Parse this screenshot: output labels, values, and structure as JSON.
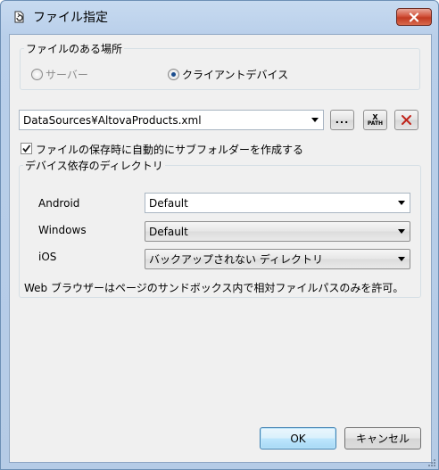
{
  "window": {
    "title": "ファイル指定"
  },
  "location_group": {
    "legend": "ファイルのある場所",
    "options": [
      {
        "label": "サーバー",
        "selected": false,
        "enabled": false
      },
      {
        "label": "クライアントデバイス",
        "selected": true,
        "enabled": true
      }
    ]
  },
  "file": {
    "path": "DataSources¥AltovaProducts.xml",
    "browse_label": "...",
    "xpath_label_top": "X",
    "xpath_label_bottom": "PATH"
  },
  "subfolder_checkbox": {
    "label": "ファイルの保存時に自動的にサブフォルダーを作成する",
    "checked": true
  },
  "device_dirs": {
    "legend": "デバイス依存のディレクトリ",
    "rows": [
      {
        "label": "Android",
        "value": "Default"
      },
      {
        "label": "Windows",
        "value": "Default"
      },
      {
        "label": "iOS",
        "value": "バックアップされない ディレクトリ"
      }
    ],
    "note": "Web ブラウザーはページのサンドボックス内で相対ファイルパスのみを許可。"
  },
  "buttons": {
    "ok": "OK",
    "cancel": "キャンセル"
  },
  "colors": {
    "accent": "#1b4d8e",
    "close": "#c23a22",
    "delete_x": "#c0241b"
  }
}
